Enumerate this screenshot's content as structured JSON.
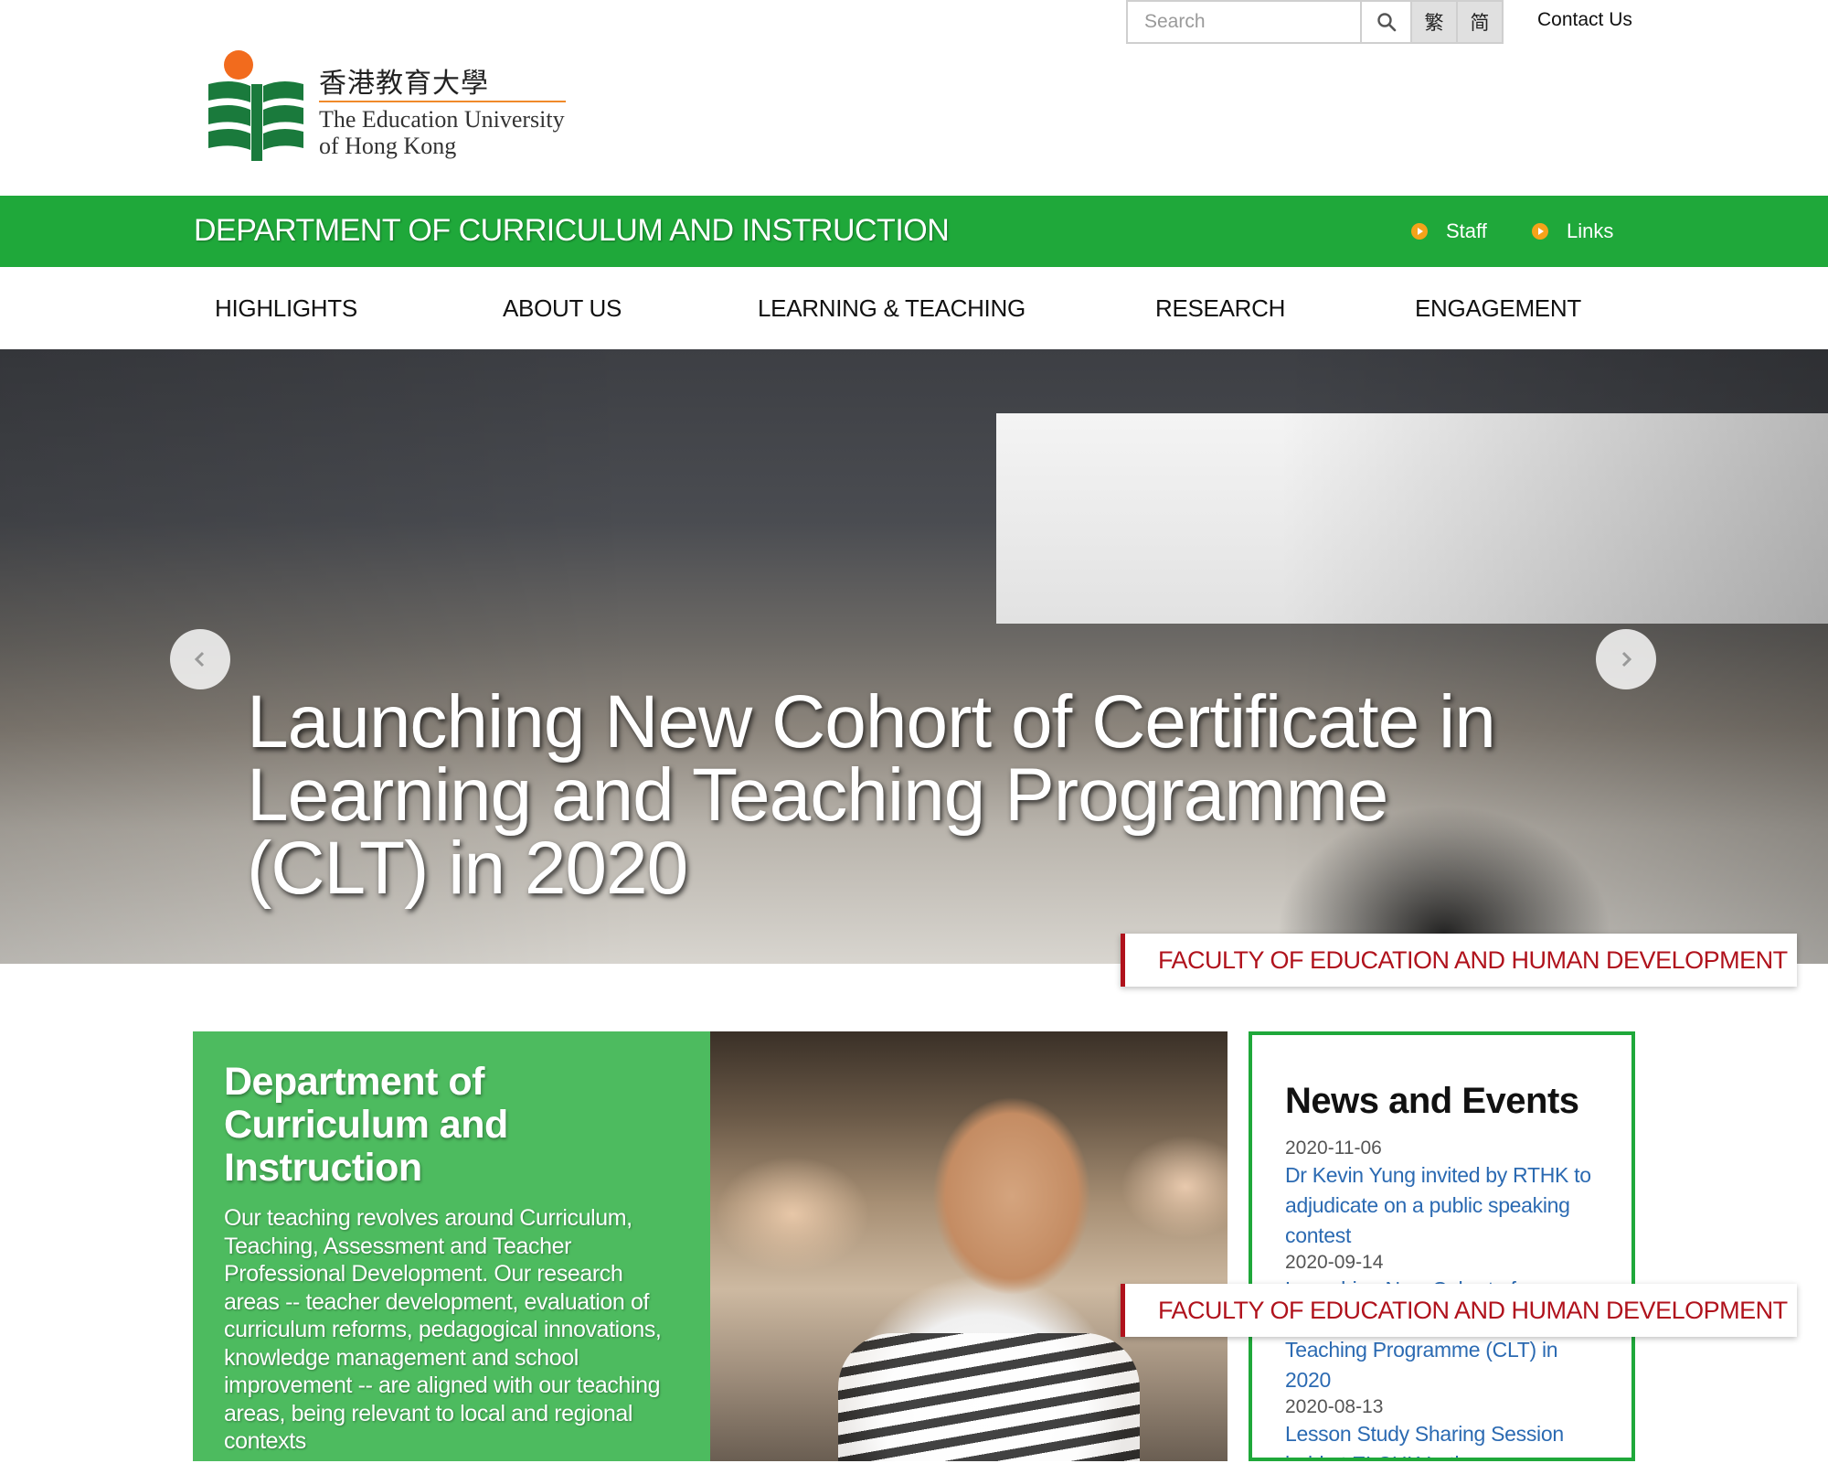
{
  "utility": {
    "search_placeholder": "Search",
    "lang_traditional": "繁",
    "lang_simplified": "简",
    "contact": "Contact Us"
  },
  "logo": {
    "chinese_name": "香港教育大學",
    "english_line1": "The Education University",
    "english_line2": "of Hong Kong"
  },
  "dept_bar": {
    "title": "DEPARTMENT OF CURRICULUM AND INSTRUCTION",
    "links": [
      "Staff",
      "Links"
    ]
  },
  "nav": {
    "items": [
      "HIGHLIGHTS",
      "ABOUT US",
      "LEARNING & TEACHING",
      "RESEARCH",
      "ENGAGEMENT"
    ]
  },
  "hero": {
    "caption": "Launching New Cohort of Certificate in Learning and Teaching Programme (CLT) in 2020"
  },
  "faculty_label": "FACULTY OF EDUCATION AND HUMAN DEVELOPMENT",
  "dept_panel": {
    "title": "Department of Curriculum and Instruction",
    "body": "Our teaching revolves around Curriculum, Teaching, Assessment and Teacher Professional Development. Our research areas -- teacher development, evaluation of curriculum reforms, pedagogical innovations, knowledge management and school improvement -- are aligned with our teaching areas, being relevant to local and regional contexts"
  },
  "news": {
    "heading": "News and Events",
    "items": [
      {
        "date": "2020-11-06",
        "title": "Dr Kevin Yung invited by RTHK to adjudicate on a public speaking contest"
      },
      {
        "date": "2020-09-14",
        "title": "Launching New Cohort of Certificate in Learning and Teaching Programme (CLT) in 2020"
      },
      {
        "date": "2020-08-13",
        "title": "Lesson Study Sharing Session held at ELCHK Lutheran"
      }
    ]
  },
  "colors": {
    "brand_green": "#1fa83a",
    "panel_green": "#4dbb5f",
    "faculty_red": "#b0121c",
    "link_blue": "#2b6ab2",
    "bullet_orange": "#f5a31a"
  }
}
